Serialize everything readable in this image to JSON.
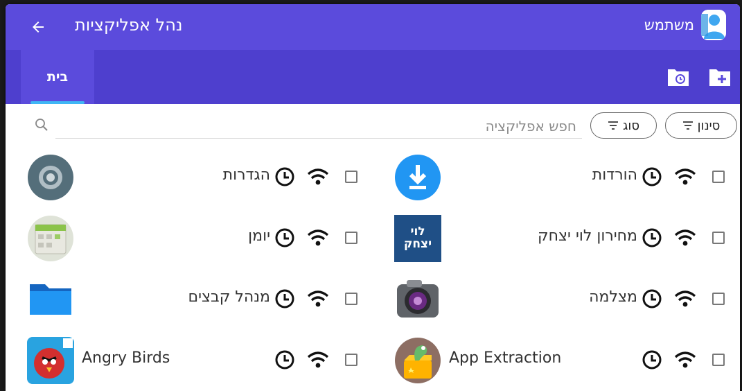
{
  "header": {
    "title": "נהל אפליקציות",
    "user_name": "משתמש",
    "back_icon": "arrow-left-icon",
    "avatar_icon": "user-avatar-icon"
  },
  "tabs": {
    "home_label": "בית",
    "actions": [
      "add-folder-icon",
      "clock-folder-icon"
    ]
  },
  "filters": {
    "search_placeholder": "חפש אפליקציה",
    "filter_label": "סינון",
    "type_label": "סוג"
  },
  "colors": {
    "primary": "#5b4bdc",
    "primary_dark": "#4e3fce",
    "tab_indicator": "#3fb6f5"
  },
  "apps": [
    {
      "name": "הורדות",
      "icon": "downloads-icon"
    },
    {
      "name": "הגדרות",
      "icon": "settings-icon"
    },
    {
      "name": "מחירון לוי יצחק",
      "icon": "levi-yitzhak-icon",
      "icon_text_top": "לוי",
      "icon_text_bottom": "יצחק"
    },
    {
      "name": "יומן",
      "icon": "calendar-icon"
    },
    {
      "name": "מצלמה",
      "icon": "camera-icon"
    },
    {
      "name": "מנהל קבצים",
      "icon": "files-icon"
    },
    {
      "name": "App Extraction",
      "icon": "app-extraction-icon"
    },
    {
      "name": "Angry Birds",
      "icon": "angry-birds-icon"
    }
  ]
}
